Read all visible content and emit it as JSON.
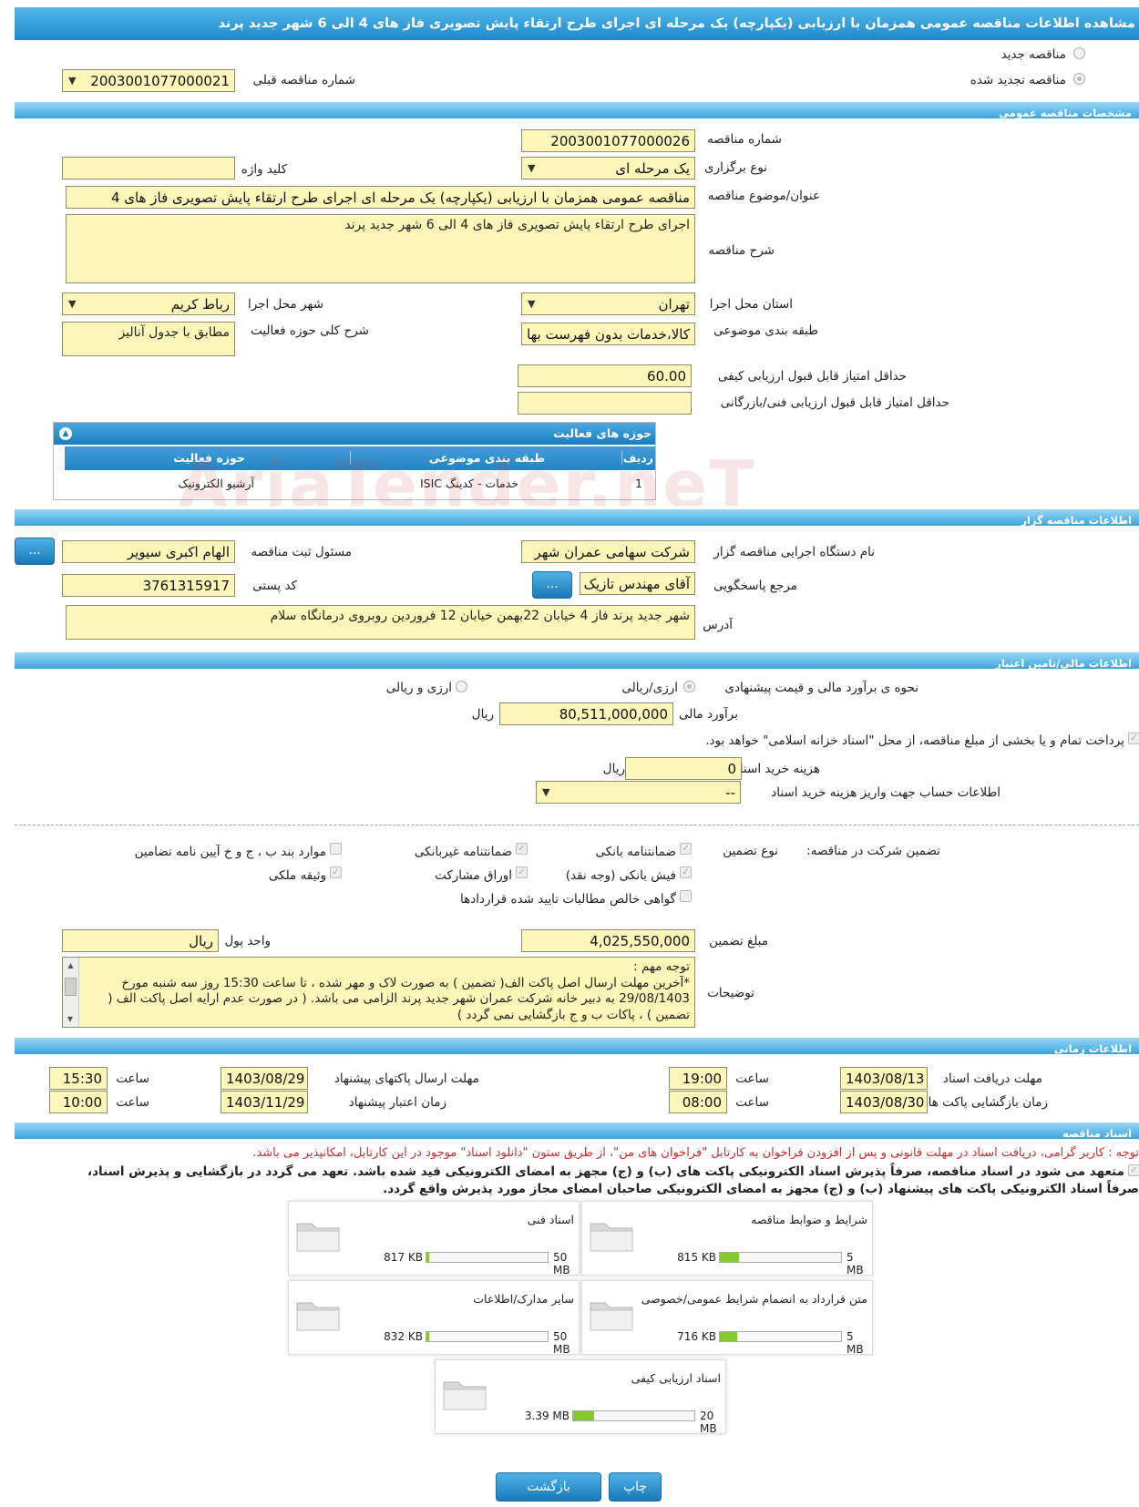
{
  "page_title": "مشاهده اطلاعات مناقصه عمومی همزمان با ارزیابی (یکپارچه) یک مرحله ای اجرای طرح ارتقاء پایش تصویری فاز های 4 الی 6 شهر جدید پرند",
  "top": {
    "new_tender": "مناقصه جدید",
    "renewed_tender": "مناقصه تجدید شده",
    "prev_number_label": "شماره مناقصه قبلی",
    "prev_number": "2003001077000021"
  },
  "sections": {
    "general": "مشخصات مناقصه عمومی",
    "organizer": "اطلاعات مناقصه گزار",
    "financial": "اطلاعات مالی/تامین اعتبار",
    "timing": "اطلاعات زمانی",
    "documents": "اسناد مناقصه"
  },
  "general": {
    "number_label": "شماره مناقصه",
    "number": "2003001077000026",
    "type_label": "نوع برگزاری",
    "type": "یک مرحله ای",
    "keyword_label": "کلید واژه",
    "keyword": "",
    "subject_label": "عنوان/موضوع مناقصه",
    "subject": "مناقصه عمومی همزمان با ارزیابی (یکپارچه) یک مرحله ای  اجرای طرح ارتقاء پایش تصویری فاز های 4",
    "desc_label": "شرح مناقصه",
    "desc": "اجرای طرح ارتقاء پایش تصویری فاز های 4 الی 6 شهر جدید پرند",
    "province_label": "استان محل اجرا",
    "province": "تهران",
    "city_label": "شهر محل اجرا",
    "city": "رباط کریم",
    "category_label": "طبقه بندی موضوعی",
    "category": "کالا،خدمات بدون فهرست بها",
    "activity_desc_label": "شرح کلی حوزه فعالیت",
    "activity_desc": "مطابق با جدول آنالیز",
    "min_quality_label": "حداقل امتیاز قابل قبول ارزیابی کیفی",
    "min_quality": "60.00",
    "min_tech_label": "حداقل امتیاز قابل قبول ارزیابی فنی/بازرگانی",
    "min_tech": ""
  },
  "activity_table": {
    "title": "حوزه های فعالیت",
    "headers": [
      "ردیف",
      "طبقه بندی موضوعی",
      "حوزه فعالیت"
    ],
    "rows": [
      [
        "1",
        "خدمات - کدینگ ISIC",
        "آرشیو الکترونیک"
      ]
    ]
  },
  "organizer": {
    "org_label": "نام دستگاه اجرایی مناقصه گزار",
    "org": "شرکت سهامی عمران شهر",
    "responsible_label": "مسئول ثبت مناقصه",
    "responsible": "الهام  اکبری سیویر",
    "reference_label": "مرجع پاسخگویی",
    "reference": "آقای مهندس تازیک",
    "postal_label": "کد پستی",
    "postal": "3761315917",
    "address_label": "آدرس",
    "address": "شهر جدید پرند فاز 4 خیابان 22بهمن خیابان 12 فروردین روبروی درمانگاه سلام",
    "more_btn": "..."
  },
  "financial": {
    "method_label": "نحوه ی برآورد مالی و قیمت پیشنهادی",
    "opt_rial": "ارزی/ریالی",
    "opt_currency": "ارزی و ریالی",
    "estimate_label": "برآورد مالی",
    "estimate": "80,511,000,000",
    "rial": "ریال",
    "treasury_note": "پرداخت تمام و یا بخشی از مبلغ مناقصه، از محل \"اسناد خزانه اسلامی\" خواهد بود.",
    "doc_cost_label": "هزینه خرید اسناد",
    "doc_cost": "0",
    "account_label": "اطلاعات حساب جهت واریز هزینه خرید اسناد",
    "account": "--",
    "guarantee_label": "تضمین شرکت در مناقصه:",
    "guarantee_type_label": "نوع تضمین",
    "g1": "ضمانتنامه بانکی",
    "g2": "ضمانتنامه غیربانکی",
    "g3": "موارد بند ب ، ج و خ آیین نامه تضامین",
    "g4": "فیش بانکی (وجه نقد)",
    "g5": "اوراق مشارکت",
    "g6": "وثیقه ملکی",
    "g7": "گواهی خالص مطالبات تایید شده قراردادها",
    "amount_label": "مبلغ تضمین",
    "amount": "4,025,550,000",
    "unit_label": "واحد پول",
    "unit": "ریال",
    "notes_label": "توضیحات",
    "notes": "توجه مهم :\n*آخرین مهلت ارسال اصل پاکت الف( تضمین ) به صورت لاک و مهر شده ، تا ساعت 15:30 روز سه شنبه مورخ 29/08/1403 به دبیر خانه شرکت عمران شهر جدید پرند الزامی می باشد. ( در صورت عدم ارایه اصل پاکت الف ( تضمین ) ، پاکات ب و ج بازگشایی نمی گردد )"
  },
  "timing": {
    "receive_label": "مهلت دریافت اسناد",
    "receive_date": "1403/08/13",
    "receive_time": "19:00",
    "send_label": "مهلت ارسال پاکتهای پیشنهاد",
    "send_date": "1403/08/29",
    "send_time": "15:30",
    "open_label": "زمان بازگشایی پاکت ها",
    "open_date": "1403/08/30",
    "open_time": "08:00",
    "valid_label": "زمان اعتبار پیشنهاد",
    "valid_date": "1403/11/29",
    "valid_time": "10:00",
    "time_label": "ساعت"
  },
  "documents": {
    "notice": "توجه : کاربر گرامی، دریافت اسناد در مهلت قانونی و پس از افزودن فراخوان به کارتابل \"فراخوان های من\"، از طریق ستون \"دانلود اسناد\" موجود در این کارتابل، امکانپذیر می باشد.",
    "commit_line1": "متعهد می شود در اسناد مناقصه، صرفاً پذیرش اسناد الکترونیکی پاکت های (ب) و (ج) مجهز به امضای الکترونیکی قید شده باشد. تعهد می گردد در بازگشایی و پذیرش اسناد،",
    "commit_line2": "صرفاً اسناد الکترونیکی پاکت های پیشنهاد (ب) و (ج) مجهز به امضای الکترونیکی صاحبان امضای مجاز مورد پذیرش واقع گردد.",
    "files": [
      {
        "title": "شرایط و ضوابط مناقصه",
        "size": "815 KB",
        "max": "5 MB",
        "fill": 0.16
      },
      {
        "title": "اسناد فنی",
        "size": "817 KB",
        "max": "50 MB",
        "fill": 0.02
      },
      {
        "title": "متن قرارداد به انضمام شرایط عمومی/خصوصی",
        "size": "716 KB",
        "max": "5 MB",
        "fill": 0.14
      },
      {
        "title": "سایر مدارک/اطلاعات",
        "size": "832 KB",
        "max": "50 MB",
        "fill": 0.02
      },
      {
        "title": "اسناد ارزیابی کیفی",
        "size": "3.39 MB",
        "max": "20 MB",
        "fill": 0.17
      }
    ]
  },
  "buttons": {
    "print": "چاپ",
    "back": "بازگشت"
  },
  "watermark": "AriaTender.neT"
}
